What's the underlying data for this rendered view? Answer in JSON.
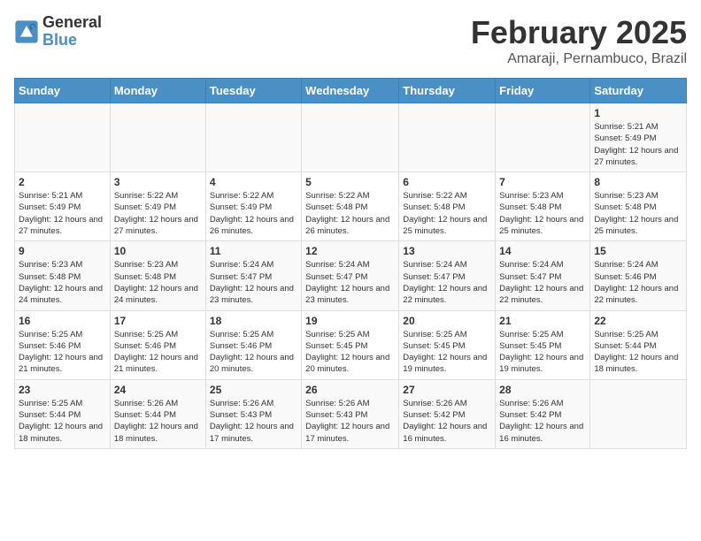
{
  "header": {
    "logo_line1": "General",
    "logo_line2": "Blue",
    "title": "February 2025",
    "subtitle": "Amaraji, Pernambuco, Brazil"
  },
  "days_of_week": [
    "Sunday",
    "Monday",
    "Tuesday",
    "Wednesday",
    "Thursday",
    "Friday",
    "Saturday"
  ],
  "weeks": [
    [
      {
        "day": "",
        "info": ""
      },
      {
        "day": "",
        "info": ""
      },
      {
        "day": "",
        "info": ""
      },
      {
        "day": "",
        "info": ""
      },
      {
        "day": "",
        "info": ""
      },
      {
        "day": "",
        "info": ""
      },
      {
        "day": "1",
        "info": "Sunrise: 5:21 AM\nSunset: 5:49 PM\nDaylight: 12 hours and 27 minutes."
      }
    ],
    [
      {
        "day": "2",
        "info": "Sunrise: 5:21 AM\nSunset: 5:49 PM\nDaylight: 12 hours and 27 minutes."
      },
      {
        "day": "3",
        "info": "Sunrise: 5:22 AM\nSunset: 5:49 PM\nDaylight: 12 hours and 27 minutes."
      },
      {
        "day": "4",
        "info": "Sunrise: 5:22 AM\nSunset: 5:49 PM\nDaylight: 12 hours and 26 minutes."
      },
      {
        "day": "5",
        "info": "Sunrise: 5:22 AM\nSunset: 5:48 PM\nDaylight: 12 hours and 26 minutes."
      },
      {
        "day": "6",
        "info": "Sunrise: 5:22 AM\nSunset: 5:48 PM\nDaylight: 12 hours and 25 minutes."
      },
      {
        "day": "7",
        "info": "Sunrise: 5:23 AM\nSunset: 5:48 PM\nDaylight: 12 hours and 25 minutes."
      },
      {
        "day": "8",
        "info": "Sunrise: 5:23 AM\nSunset: 5:48 PM\nDaylight: 12 hours and 25 minutes."
      }
    ],
    [
      {
        "day": "9",
        "info": "Sunrise: 5:23 AM\nSunset: 5:48 PM\nDaylight: 12 hours and 24 minutes."
      },
      {
        "day": "10",
        "info": "Sunrise: 5:23 AM\nSunset: 5:48 PM\nDaylight: 12 hours and 24 minutes."
      },
      {
        "day": "11",
        "info": "Sunrise: 5:24 AM\nSunset: 5:47 PM\nDaylight: 12 hours and 23 minutes."
      },
      {
        "day": "12",
        "info": "Sunrise: 5:24 AM\nSunset: 5:47 PM\nDaylight: 12 hours and 23 minutes."
      },
      {
        "day": "13",
        "info": "Sunrise: 5:24 AM\nSunset: 5:47 PM\nDaylight: 12 hours and 22 minutes."
      },
      {
        "day": "14",
        "info": "Sunrise: 5:24 AM\nSunset: 5:47 PM\nDaylight: 12 hours and 22 minutes."
      },
      {
        "day": "15",
        "info": "Sunrise: 5:24 AM\nSunset: 5:46 PM\nDaylight: 12 hours and 22 minutes."
      }
    ],
    [
      {
        "day": "16",
        "info": "Sunrise: 5:25 AM\nSunset: 5:46 PM\nDaylight: 12 hours and 21 minutes."
      },
      {
        "day": "17",
        "info": "Sunrise: 5:25 AM\nSunset: 5:46 PM\nDaylight: 12 hours and 21 minutes."
      },
      {
        "day": "18",
        "info": "Sunrise: 5:25 AM\nSunset: 5:46 PM\nDaylight: 12 hours and 20 minutes."
      },
      {
        "day": "19",
        "info": "Sunrise: 5:25 AM\nSunset: 5:45 PM\nDaylight: 12 hours and 20 minutes."
      },
      {
        "day": "20",
        "info": "Sunrise: 5:25 AM\nSunset: 5:45 PM\nDaylight: 12 hours and 19 minutes."
      },
      {
        "day": "21",
        "info": "Sunrise: 5:25 AM\nSunset: 5:45 PM\nDaylight: 12 hours and 19 minutes."
      },
      {
        "day": "22",
        "info": "Sunrise: 5:25 AM\nSunset: 5:44 PM\nDaylight: 12 hours and 18 minutes."
      }
    ],
    [
      {
        "day": "23",
        "info": "Sunrise: 5:25 AM\nSunset: 5:44 PM\nDaylight: 12 hours and 18 minutes."
      },
      {
        "day": "24",
        "info": "Sunrise: 5:26 AM\nSunset: 5:44 PM\nDaylight: 12 hours and 18 minutes."
      },
      {
        "day": "25",
        "info": "Sunrise: 5:26 AM\nSunset: 5:43 PM\nDaylight: 12 hours and 17 minutes."
      },
      {
        "day": "26",
        "info": "Sunrise: 5:26 AM\nSunset: 5:43 PM\nDaylight: 12 hours and 17 minutes."
      },
      {
        "day": "27",
        "info": "Sunrise: 5:26 AM\nSunset: 5:42 PM\nDaylight: 12 hours and 16 minutes."
      },
      {
        "day": "28",
        "info": "Sunrise: 5:26 AM\nSunset: 5:42 PM\nDaylight: 12 hours and 16 minutes."
      },
      {
        "day": "",
        "info": ""
      }
    ]
  ]
}
